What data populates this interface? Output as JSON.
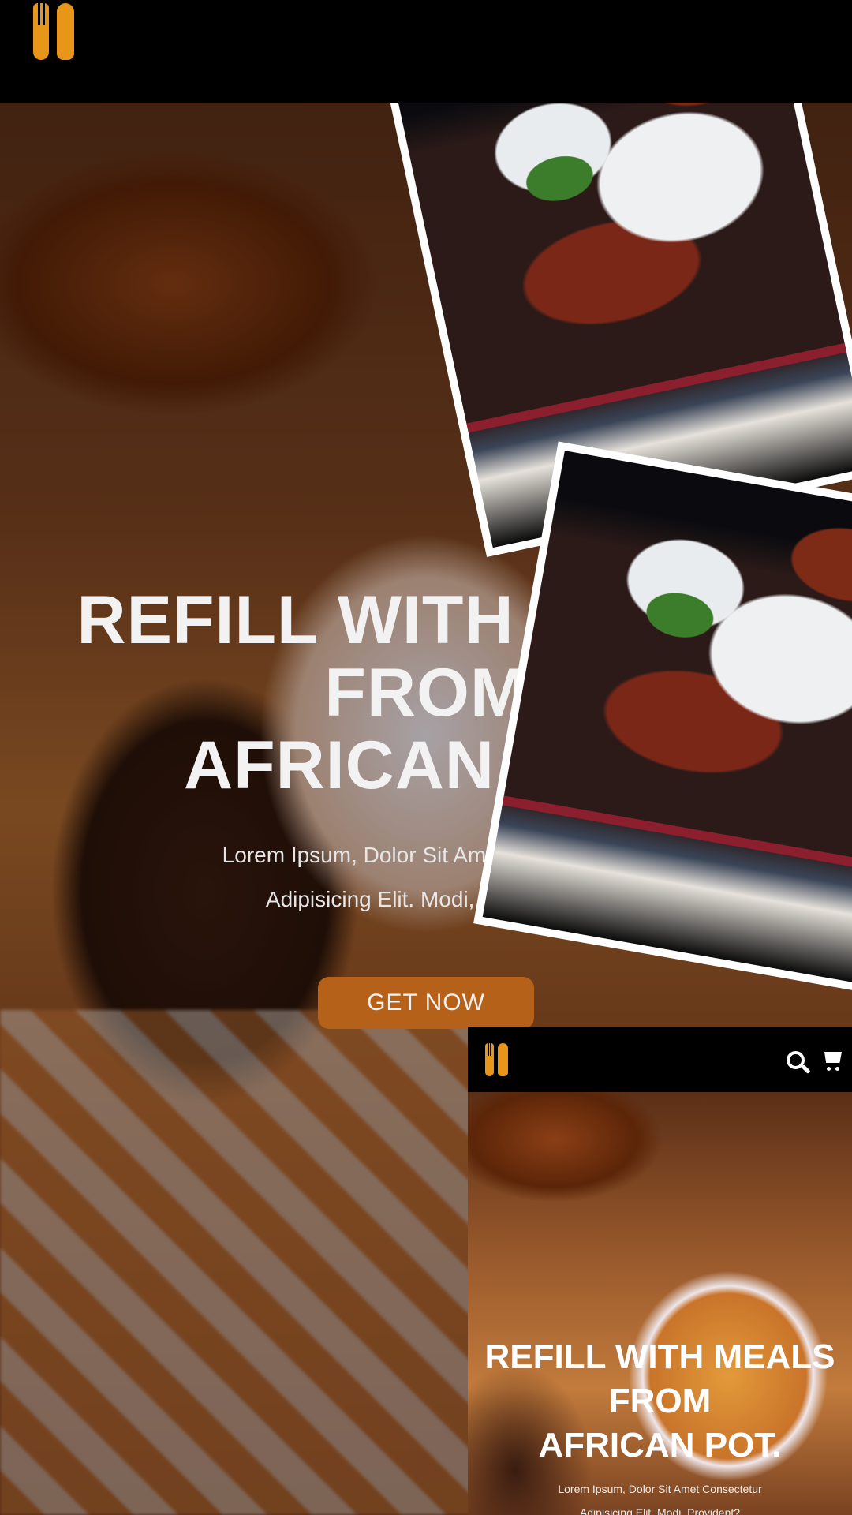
{
  "main": {
    "hero": {
      "title": "REFILL WITH MEALS\nFROM\nAFRICAN POT.",
      "text": "Lorem Ipsum, Dolor Sit Amet Consectetur\nAdipisicing Elit. Modi, Provident?",
      "cta_label": "GET NOW"
    }
  },
  "preview": {
    "hero": {
      "title": "REFILL WITH MEALS\nFROM\nAFRICAN POT.",
      "text": "Lorem Ipsum, Dolor Sit Amet Consectetur\nAdipisicing Elit. Modi, Provident?"
    }
  },
  "colors": {
    "accent": "#e8961a",
    "button": "#b5611a",
    "header": "#000000"
  },
  "icons": {
    "logo": "fork-spoon-icon",
    "search": "search-icon",
    "cart": "cart-icon"
  }
}
